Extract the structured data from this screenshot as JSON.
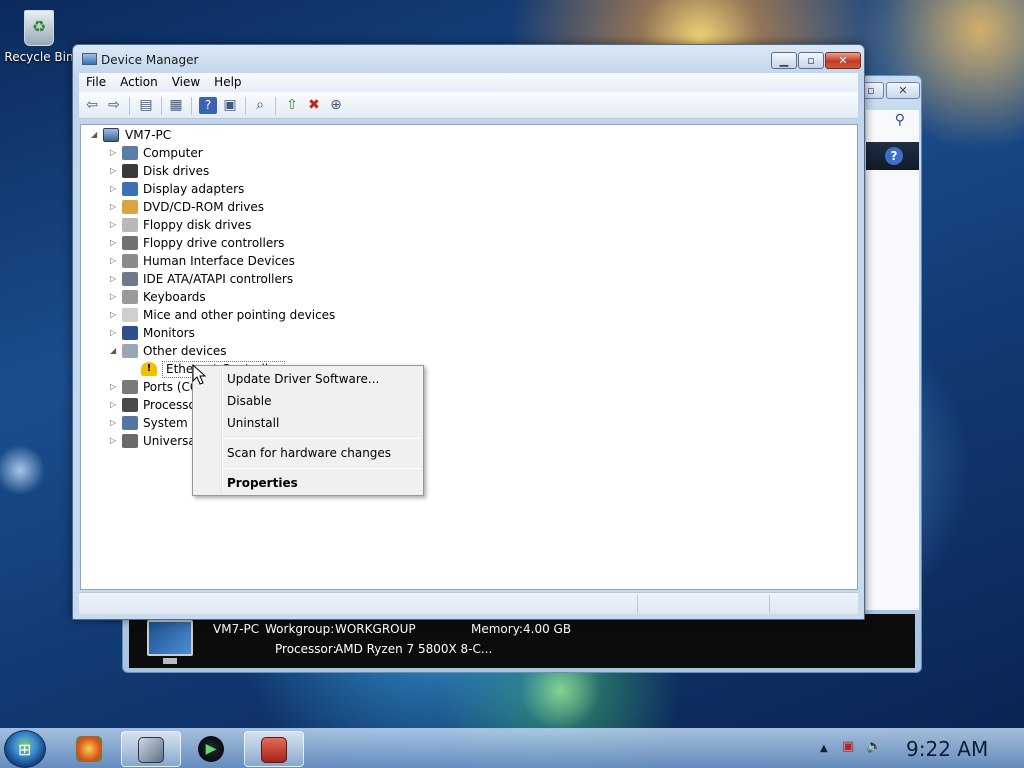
{
  "desktop": {
    "recycle_bin_label": "Recycle Bin"
  },
  "background_window": {
    "computer_name": "VM7-PC",
    "workgroup_label": "Workgroup:",
    "workgroup_value": "WORKGROUP",
    "memory_label": "Memory:",
    "memory_value": "4.00 GB",
    "processor_label": "Processor:",
    "processor_value": "AMD Ryzen 7 5800X 8-C..."
  },
  "window": {
    "title": "Device Manager"
  },
  "menubar": [
    "File",
    "Action",
    "View",
    "Help"
  ],
  "tree": {
    "root": "VM7-PC",
    "items": [
      "Computer",
      "Disk drives",
      "Display adapters",
      "DVD/CD-ROM drives",
      "Floppy disk drives",
      "Floppy drive controllers",
      "Human Interface Devices",
      "IDE ATA/ATAPI controllers",
      "Keyboards",
      "Mice and other pointing devices",
      "Monitors",
      "Other devices",
      "Ethernet Controller",
      "Ports (COM & LPT)",
      "Processors",
      "System devices",
      "Universal Serial Bus controllers"
    ]
  },
  "context_menu": {
    "update_driver": "Update Driver Software...",
    "disable": "Disable",
    "uninstall": "Uninstall",
    "scan": "Scan for hardware changes",
    "properties": "Properties"
  },
  "taskbar": {
    "clock": "9:22 AM"
  },
  "colors": {
    "accent": "#3d6fc6",
    "close_button": "#c23a24",
    "warning": "#f2c200"
  }
}
